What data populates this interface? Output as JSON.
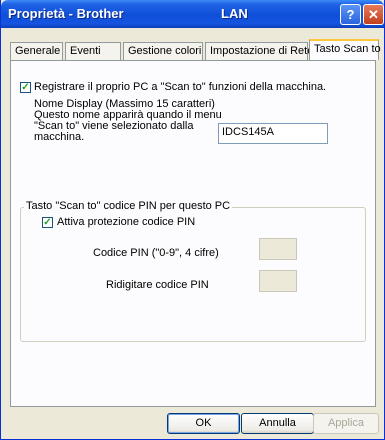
{
  "window": {
    "title_left": "Proprietà - Brother",
    "title_right": "LAN",
    "help_glyph": "?",
    "close_glyph": "✕"
  },
  "tabs": [
    {
      "label": "Generale"
    },
    {
      "label": "Eventi"
    },
    {
      "label": "Gestione colori"
    },
    {
      "label": "Impostazione di Rete"
    },
    {
      "label": "Tasto Scan to",
      "active": true
    }
  ],
  "register": {
    "checked": true,
    "label": "Registrare il proprio PC a \"Scan to\" funzioni della macchina."
  },
  "display_name": {
    "description": "Nome Display (Massimo 15 caratteri) Questo nome apparirà quando il menu \"Scan to\" viene selezionato dalla macchina.",
    "value": "IDCS145A"
  },
  "pin_group": {
    "title": "Tasto \"Scan to\" codice PIN per questo PC",
    "protect_checked": true,
    "protect_label": "Attiva protezione codice PIN",
    "pin_label": "Codice PIN (\"0-9\", 4 cifre)",
    "pin_value": "",
    "retype_label": "Ridigitare codice PIN",
    "retype_value": ""
  },
  "buttons": {
    "ok": "OK",
    "cancel": "Annulla",
    "apply": "Applica"
  }
}
